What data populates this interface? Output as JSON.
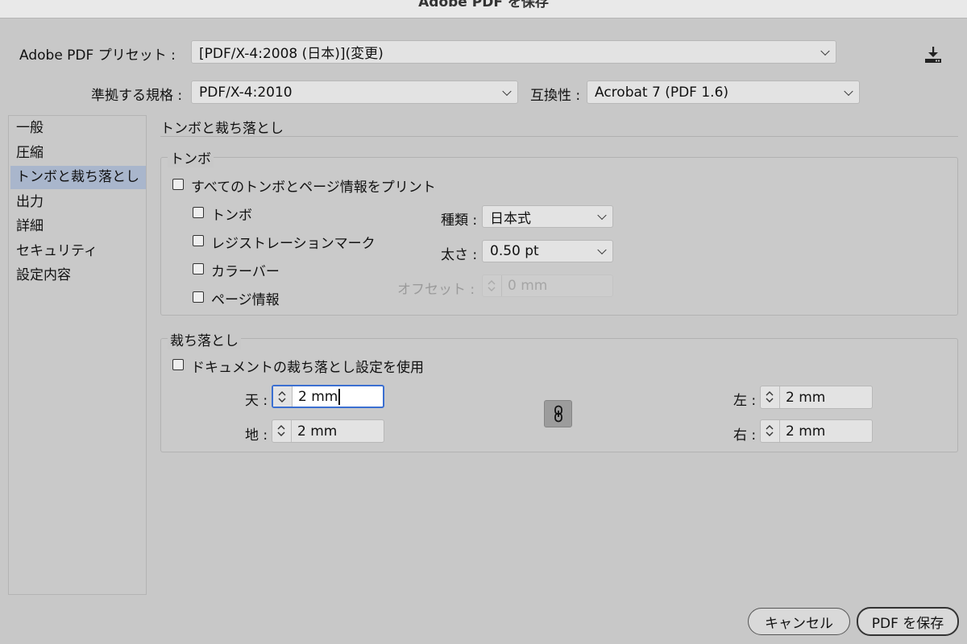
{
  "window": {
    "title": "Adobe PDF を保存"
  },
  "header": {
    "preset_label": "Adobe PDF プリセット :",
    "preset_value": "[PDF/X-4:2008 (日本)](変更)",
    "standard_label": "準拠する規格 :",
    "standard_value": "PDF/X-4:2010",
    "compat_label": "互換性 :",
    "compat_value": "Acrobat 7 (PDF 1.6)"
  },
  "sidebar": {
    "items": [
      {
        "label": "一般"
      },
      {
        "label": "圧縮"
      },
      {
        "label": "トンボと裁ち落とし"
      },
      {
        "label": "出力"
      },
      {
        "label": "詳細"
      },
      {
        "label": "セキュリティ"
      },
      {
        "label": "設定内容"
      }
    ],
    "selected_index": 2
  },
  "section": {
    "title": "トンボと裁ち落とし"
  },
  "marks": {
    "legend": "トンボ",
    "all_marks_label": "すべてのトンボとページ情報をプリント",
    "trim_marks_label": "トンボ",
    "registration_label": "レジストレーションマーク",
    "color_bars_label": "カラーバー",
    "page_info_label": "ページ情報",
    "type_label": "種類 :",
    "type_value": "日本式",
    "weight_label": "太さ :",
    "weight_value": "0.50 pt",
    "offset_label": "オフセット :",
    "offset_value": "0 mm"
  },
  "bleed": {
    "legend": "裁ち落とし",
    "use_doc_label": "ドキュメントの裁ち落とし設定を使用",
    "top_label": "天 :",
    "top_value": "2 mm",
    "bottom_label": "地 :",
    "bottom_value": "2 mm",
    "left_label": "左 :",
    "left_value": "2 mm",
    "right_label": "右 :",
    "right_value": "2 mm"
  },
  "footer": {
    "cancel_label": "キャンセル",
    "save_label": "PDF を保存"
  }
}
